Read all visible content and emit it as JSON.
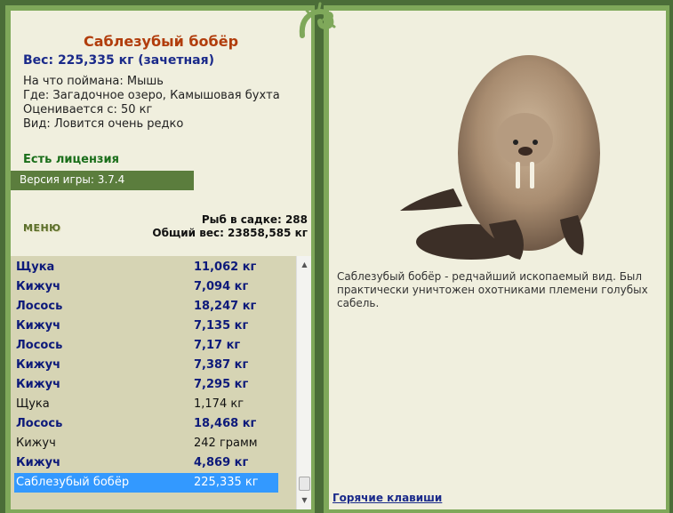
{
  "fish": {
    "title": "Саблезубый бобёр",
    "weight": "Вес: 225,335 кг (зачетная)",
    "caught_on": "На что поймана: Мышь",
    "where": "Где: Загадочное озеро, Камышовая бухта",
    "valued_from": "Оценивается с: 50 кг",
    "kind": "Вид: Ловится очень редко"
  },
  "license": "Есть лицензия",
  "version": "Версия игры: 3.7.4",
  "menu_label": "МЕНЮ",
  "stats": {
    "fish_in_net": "Рыб в садке: 288",
    "total_weight": "Общий вес: 23858,585 кг"
  },
  "catch_list": [
    {
      "name": "Щука",
      "weight": "11,062 кг",
      "style": "bold"
    },
    {
      "name": "Кижуч",
      "weight": "7,094 кг",
      "style": "bold"
    },
    {
      "name": "Лосось",
      "weight": "18,247 кг",
      "style": "bold"
    },
    {
      "name": "Кижуч",
      "weight": "7,135 кг",
      "style": "bold"
    },
    {
      "name": "Лосось",
      "weight": "7,17 кг",
      "style": "bold"
    },
    {
      "name": "Кижуч",
      "weight": "7,387 кг",
      "style": "bold"
    },
    {
      "name": "Кижуч",
      "weight": "7,295 кг",
      "style": "bold"
    },
    {
      "name": "Щука",
      "weight": "1,174 кг",
      "style": "plain"
    },
    {
      "name": "Лосось",
      "weight": "18,468 кг",
      "style": "bold"
    },
    {
      "name": "Кижуч",
      "weight": "242 грамм",
      "style": "plain"
    },
    {
      "name": "Кижуч",
      "weight": "4,869 кг",
      "style": "bold"
    },
    {
      "name": "Саблезубый бобёр",
      "weight": "225,335 кг",
      "style": "selected"
    }
  ],
  "description": "Саблезубый бобёр - редчайший ископаемый вид. Был практически уничтожен охотниками племени голубых сабель.",
  "hotkeys": "Горячие клавиши",
  "icons": {
    "beaver": "beaver-image",
    "lizard": "lizard-ornament",
    "scroll_up": "scroll-up-arrow",
    "scroll_down": "scroll-down-arrow"
  },
  "colors": {
    "frame": "#4b6d38",
    "title": "#b13d0c",
    "accent_blue": "#1a2a8a",
    "license_green": "#1a6e1a",
    "selected": "#3399ff"
  }
}
